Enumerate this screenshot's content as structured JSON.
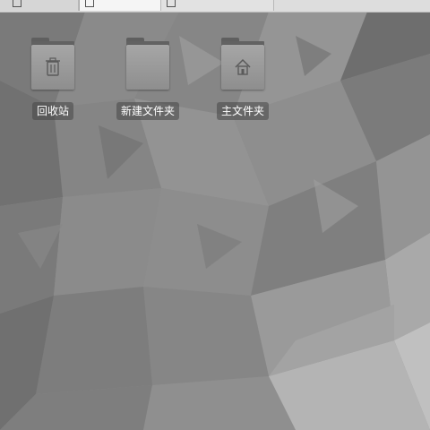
{
  "colors": {
    "wallpaper_base": "#8f8f8f",
    "taskbar": "#dcdcdc",
    "folder_body": "#9a9a9a",
    "label_bg": "#555555",
    "label_text": "#ffffff"
  },
  "taskbar": {
    "buttons": [
      {
        "icon": "window-icon"
      },
      {
        "icon": "document-icon"
      },
      {
        "icon": "document-icon"
      }
    ]
  },
  "desktop": {
    "icons": [
      {
        "label": "回收站",
        "icon": "trash-icon"
      },
      {
        "label": "新建文件夹",
        "icon": "folder-icon"
      },
      {
        "label": "主文件夹",
        "icon": "home-icon"
      }
    ]
  }
}
